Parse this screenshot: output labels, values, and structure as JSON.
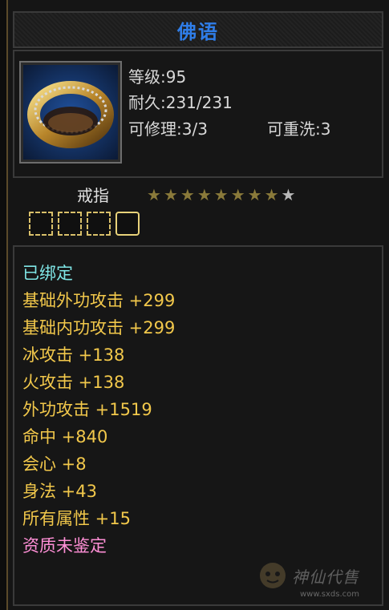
{
  "title": "佛语",
  "item": {
    "level": "等级:95",
    "durability": "耐久:231/231",
    "repairs": "可修理:3/3",
    "rewash": "可重洗:3",
    "type_name": "戒指",
    "stars_total": 9,
    "stars_filled": 8,
    "sockets": 4
  },
  "colors": {
    "title": "#2f7de8",
    "bound": "#7fe6e6",
    "stat": "#f2c84b",
    "unidentified": "#ff8fd6",
    "star_filled": "#8a7a3a",
    "star_empty": "#b8b8b8"
  },
  "attributes": [
    {
      "text": "已绑定",
      "kind": "bound"
    },
    {
      "text": "基础外功攻击 +299",
      "kind": "stat"
    },
    {
      "text": "基础内功攻击 +299",
      "kind": "stat"
    },
    {
      "text": "冰攻击 +138",
      "kind": "stat"
    },
    {
      "text": "火攻击 +138",
      "kind": "stat"
    },
    {
      "text": "外功攻击 +1519",
      "kind": "stat"
    },
    {
      "text": "命中 +840",
      "kind": "stat"
    },
    {
      "text": "会心 +8",
      "kind": "stat"
    },
    {
      "text": "身法 +43",
      "kind": "stat"
    },
    {
      "text": "所有属性 +15",
      "kind": "stat"
    },
    {
      "text": "资质未鉴定",
      "kind": "unidentified"
    }
  ],
  "watermark": {
    "text": "神仙代售",
    "url": "www.sxds.com"
  }
}
